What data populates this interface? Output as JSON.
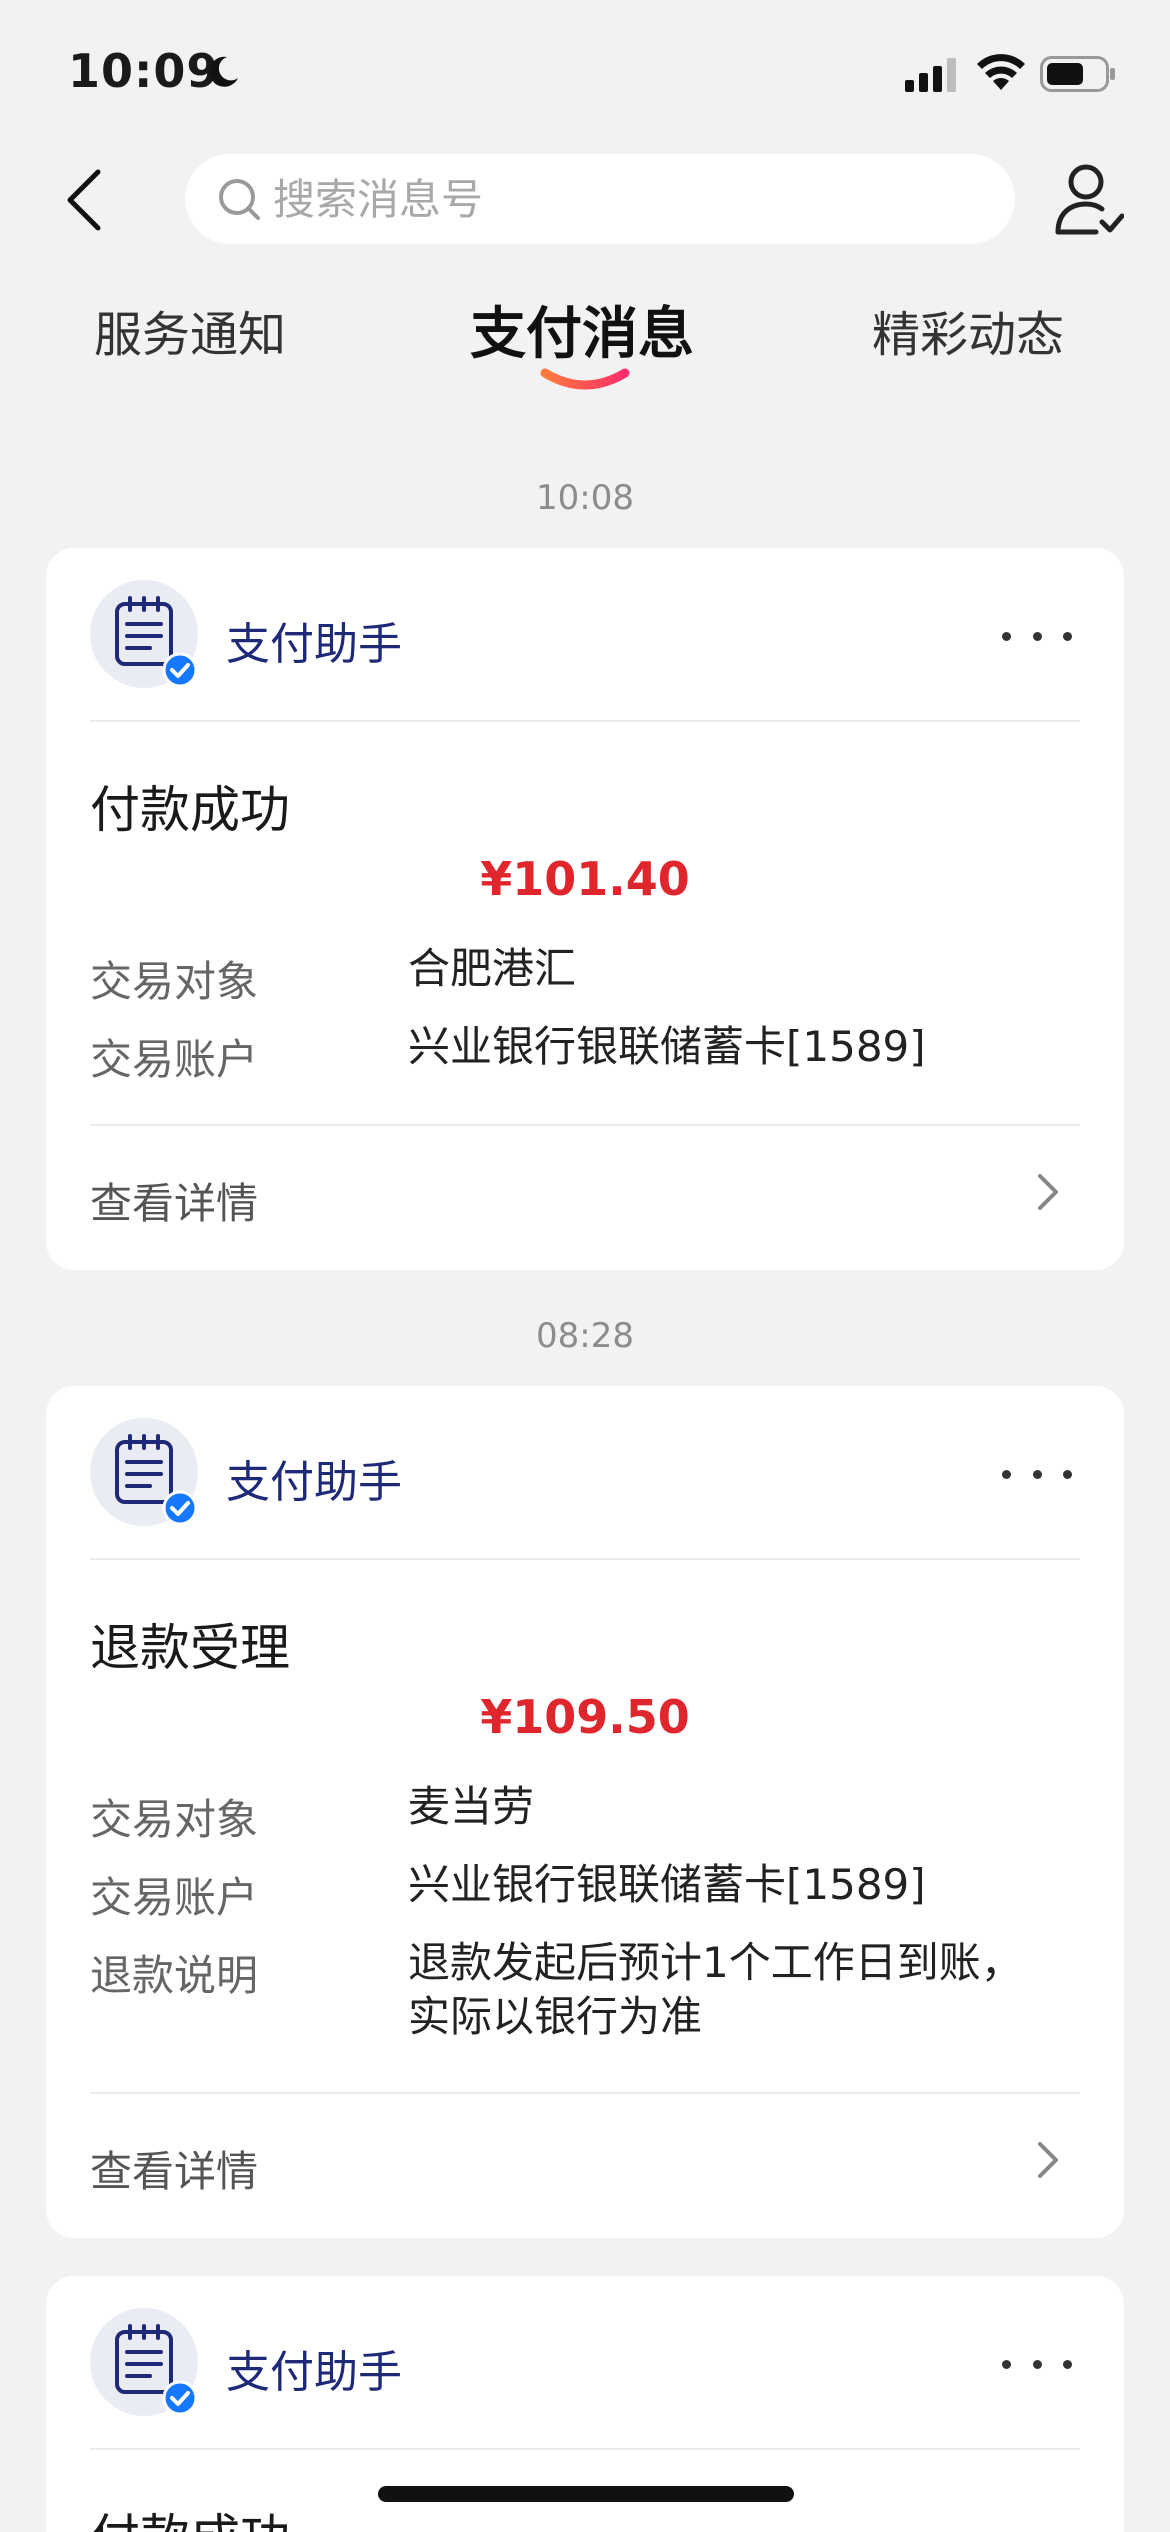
{
  "status_bar": {
    "time": "10:09"
  },
  "search": {
    "placeholder": "搜索消息号"
  },
  "tabs": [
    {
      "label": "服务通知",
      "active": false
    },
    {
      "label": "支付消息",
      "active": true
    },
    {
      "label": "精彩动态",
      "active": false
    }
  ],
  "colors": {
    "accent": "#e0262d",
    "sender": "#1e2a78",
    "tab_underline": "#ff4d5a"
  },
  "messages": [
    {
      "time": "10:08",
      "sender": "支付助手",
      "title": "付款成功",
      "amount": "¥101.40",
      "rows": [
        {
          "label": "交易对象",
          "value": "合肥港汇"
        },
        {
          "label": "交易账户",
          "value": "兴业银行银联储蓄卡[1589]"
        }
      ],
      "detail_label": "查看详情"
    },
    {
      "time": "08:28",
      "sender": "支付助手",
      "title": "退款受理",
      "amount": "¥109.50",
      "rows": [
        {
          "label": "交易对象",
          "value": "麦当劳"
        },
        {
          "label": "交易账户",
          "value": "兴业银行银联储蓄卡[1589]"
        },
        {
          "label": "退款说明",
          "value_line1": "退款发起后预计1个工作日到账，",
          "value_line2": "实际以银行为准"
        }
      ],
      "detail_label": "查看详情"
    },
    {
      "sender": "支付助手",
      "title": "付款成功"
    }
  ]
}
